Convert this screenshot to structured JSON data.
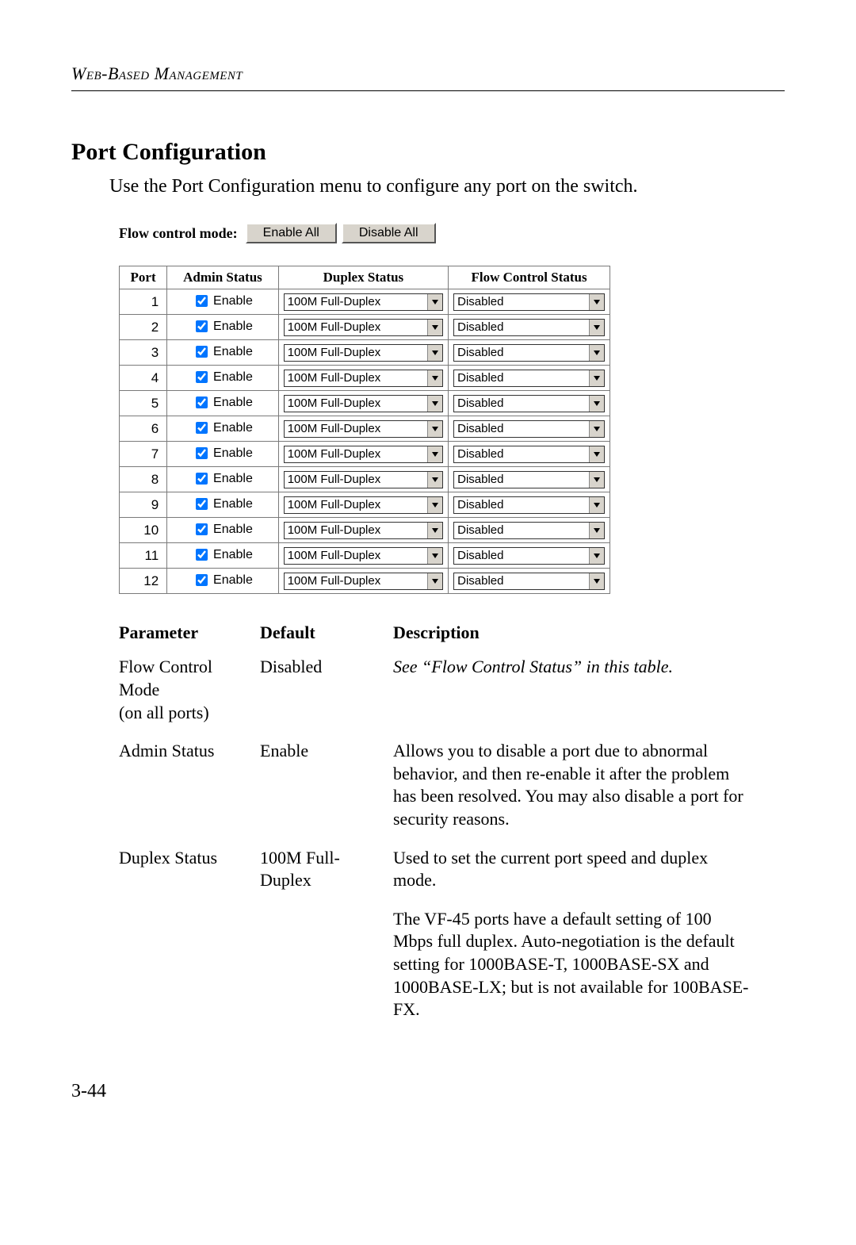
{
  "header": {
    "running_head": "Web-Based Management"
  },
  "section": {
    "title": "Port Configuration",
    "intro": "Use the Port Configuration menu to configure any port on the switch."
  },
  "screenshot": {
    "flow_control_label": "Flow control mode:",
    "enable_all": "Enable All",
    "disable_all": "Disable All",
    "columns": {
      "port": "Port",
      "admin": "Admin Status",
      "duplex": "Duplex Status",
      "flow": "Flow Control Status"
    },
    "admin_checkbox_label": "Enable",
    "ports": [
      {
        "n": "1",
        "duplex": "100M Full-Duplex",
        "flow": "Disabled"
      },
      {
        "n": "2",
        "duplex": "100M Full-Duplex",
        "flow": "Disabled"
      },
      {
        "n": "3",
        "duplex": "100M Full-Duplex",
        "flow": "Disabled"
      },
      {
        "n": "4",
        "duplex": "100M Full-Duplex",
        "flow": "Disabled"
      },
      {
        "n": "5",
        "duplex": "100M Full-Duplex",
        "flow": "Disabled"
      },
      {
        "n": "6",
        "duplex": "100M Full-Duplex",
        "flow": "Disabled"
      },
      {
        "n": "7",
        "duplex": "100M Full-Duplex",
        "flow": "Disabled"
      },
      {
        "n": "8",
        "duplex": "100M Full-Duplex",
        "flow": "Disabled"
      },
      {
        "n": "9",
        "duplex": "100M Full-Duplex",
        "flow": "Disabled"
      },
      {
        "n": "10",
        "duplex": "100M Full-Duplex",
        "flow": "Disabled"
      },
      {
        "n": "11",
        "duplex": "100M Full-Duplex",
        "flow": "Disabled"
      },
      {
        "n": "12",
        "duplex": "100M Full-Duplex",
        "flow": "Disabled"
      }
    ]
  },
  "params": {
    "head": {
      "p": "Parameter",
      "d": "Default",
      "desc": "Description"
    },
    "rows": [
      {
        "p": "Flow Control Mode\n(on all ports)",
        "d": "Disabled",
        "desc": "See “Flow Control Status” in this table.",
        "italic": true
      },
      {
        "p": "Admin Status",
        "d": "Enable",
        "desc": "Allows you to disable a port due to abnormal behavior, and then re-enable it after the problem has been resolved. You may also disable a port for security reasons."
      },
      {
        "p": "Duplex Status",
        "d": "100M Full-Duplex",
        "desc": "Used to set the current port speed and duplex mode."
      },
      {
        "p": "",
        "d": "",
        "desc": "The VF-45 ports have a default setting of 100 Mbps full duplex. Auto-negotiation is the default setting for 1000BASE-T, 1000BASE-SX and 1000BASE-LX; but is not available for 100BASE-FX."
      }
    ]
  },
  "page_number": "3-44"
}
